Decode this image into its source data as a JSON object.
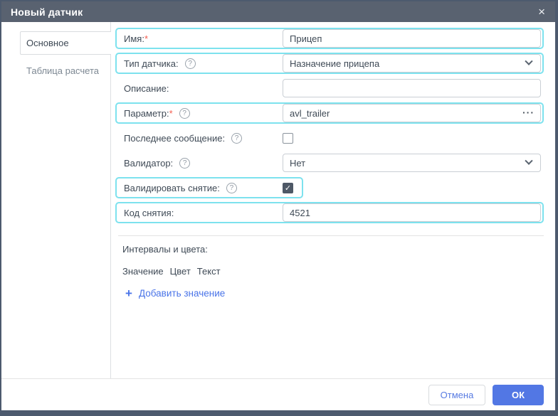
{
  "dialog": {
    "title": "Новый датчик",
    "close_glyph": "×"
  },
  "tabs": {
    "main": "Основное",
    "calc_table": "Таблица расчета"
  },
  "icons": {
    "help": "?",
    "check": "✓",
    "more": "···",
    "add_plus": "+"
  },
  "fields": {
    "name": {
      "label": "Имя:",
      "required": "*",
      "value": "Прицеп"
    },
    "sensor_type": {
      "label": "Тип датчика:",
      "value": "Назначение прицепа"
    },
    "description": {
      "label": "Описание:",
      "value": ""
    },
    "parameter": {
      "label": "Параметр:",
      "required": "*",
      "value": "avl_trailer"
    },
    "last_message": {
      "label": "Последнее сообщение:"
    },
    "validator": {
      "label": "Валидатор:",
      "value": "Нет"
    },
    "validate_unbinding": {
      "label": "Валидировать снятие:"
    },
    "unbinding_code": {
      "label": "Код снятия:",
      "value": "4521"
    }
  },
  "intervals": {
    "title": "Интервалы и цвета:",
    "columns": [
      "Значение",
      "Цвет",
      "Текст"
    ],
    "add_label": "Добавить значение"
  },
  "footer": {
    "cancel": "Отмена",
    "ok": "ОК"
  },
  "colors": {
    "titlebar": "#596270",
    "frame": "#4d5a6e",
    "highlight_cyan": "#7de2ee",
    "accent_blue": "#5277e4",
    "link_blue": "#4a74e8",
    "required_red": "#f45b4e"
  }
}
